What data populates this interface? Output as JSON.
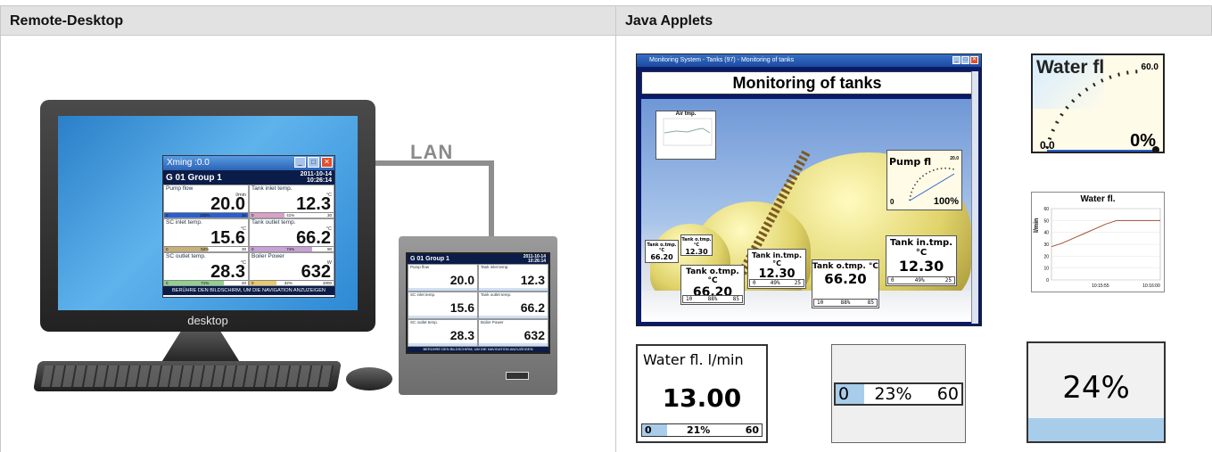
{
  "headers": {
    "left": "Remote-Desktop",
    "right": "Java Applets"
  },
  "desktop": {
    "monitor_label": "desktop",
    "lan_label": "LAN",
    "xwin": {
      "title": "Xming :0.0",
      "group": "G 01   Group 1",
      "date": "2011-10-14",
      "time": "10:26:14",
      "footer": "BERÜHRE DEN BILDSCHIRM, UM DIE NAVIGATION ANZUZEIGEN",
      "cells": [
        {
          "label": "Pump flow",
          "unit": "l/min",
          "value": "20.0",
          "min": "0",
          "pct": "100%",
          "max": "20",
          "fill": 1.0,
          "color": "#2a5fd0"
        },
        {
          "label": "Tank inlet temp.",
          "unit": "°C",
          "value": "12.3",
          "min": "0",
          "pct": "41%",
          "max": "30",
          "fill": 0.41,
          "color": "#d9a0c8"
        },
        {
          "label": "SC inlet temp.",
          "unit": "°C",
          "value": "15.6",
          "min": "0",
          "pct": "52%",
          "max": "30",
          "fill": 0.52,
          "color": "#c9b07a"
        },
        {
          "label": "Tank outlet temp.",
          "unit": "°C",
          "value": "66.2",
          "min": "0",
          "pct": "74%",
          "max": "90",
          "fill": 0.74,
          "color": "#c9a0d8"
        },
        {
          "label": "SC outlet temp.",
          "unit": "°C",
          "value": "28.3",
          "min": "0",
          "pct": "71%",
          "max": "40",
          "fill": 0.71,
          "color": "#8fd08f"
        },
        {
          "label": "Boiler Power",
          "unit": "W",
          "value": "632",
          "min": "0",
          "pct": "32%",
          "max": "2000",
          "fill": 0.32,
          "color": "#e8c870"
        }
      ]
    },
    "panel": {
      "group": "G 01   Group 1",
      "date": "2011-10-14",
      "time": "10:26:14",
      "footer": "BERÜHRE DEN BILDSCHIRM, UM DIE NAVIGATION ANZUZEIGEN",
      "cells": [
        {
          "label": "Pump flow",
          "value": "20.0"
        },
        {
          "label": "Tank inlet temp.",
          "value": "12.3"
        },
        {
          "label": "SC inlet temp.",
          "value": "15.6"
        },
        {
          "label": "Tank outlet temp.",
          "value": "66.2"
        },
        {
          "label": "SC outlet temp.",
          "value": "28.3"
        },
        {
          "label": "Boiler Power",
          "value": "632"
        }
      ]
    }
  },
  "applets": {
    "monitoring": {
      "window_title": "Monitoring System - Tanks (97) - Monitoring of tanks",
      "heading": "Monitoring of tanks",
      "mini_chart_title": "Air tmp.",
      "pump": {
        "label": "Pump fl",
        "max": "20.0",
        "min": "0",
        "pct": "100%"
      },
      "boxes": [
        {
          "title": "Tank o.tmp.°C",
          "value": "66.20"
        },
        {
          "title": "Tank o.tmp.°C",
          "value": "12.30"
        },
        {
          "title": "Tank o.tmp. °C",
          "value": "66.20",
          "min": "10",
          "pct": "88%",
          "max": "85"
        },
        {
          "title": "Tank in.tmp. °C",
          "value": "12.30",
          "min": "0",
          "pct": "49%",
          "max": "25"
        },
        {
          "title": "Tank o.tmp. °C",
          "value": "66.20",
          "min": "10",
          "pct": "88%",
          "max": "85"
        },
        {
          "title": "Tank in.tmp.°C",
          "value": "12.30",
          "min": "0",
          "pct": "49%",
          "max": "25"
        }
      ]
    },
    "gauge": {
      "label": "Water fl",
      "max": "60.0",
      "min": "0.0",
      "pct": "0%"
    },
    "chart": {
      "title": "Water fl.",
      "ylabel": "l/min",
      "xticks": [
        "10:15:55",
        "10:16:00"
      ],
      "yticks": [
        "0",
        "10",
        "20",
        "30",
        "40",
        "50",
        "60"
      ]
    },
    "chart_data": {
      "type": "line",
      "title": "Water fl.",
      "xlabel": "",
      "ylabel": "l/min",
      "ylim": [
        0,
        60
      ],
      "x": [
        0,
        1,
        2,
        3,
        4,
        5,
        6,
        7,
        8,
        9,
        10
      ],
      "series": [
        {
          "values": [
            28,
            31,
            35,
            39,
            43,
            47,
            50,
            50,
            50,
            50,
            50
          ]
        }
      ]
    },
    "numeric": {
      "title": "Water fl. l/min",
      "value": "13.00",
      "min": "0",
      "pct": "21%",
      "max": "60",
      "fill": 0.21
    },
    "hbar": {
      "min": "0",
      "pct": "23%",
      "max": "60",
      "fill": 0.23
    },
    "vbar": {
      "pct": "24%",
      "fill": 0.24
    }
  }
}
